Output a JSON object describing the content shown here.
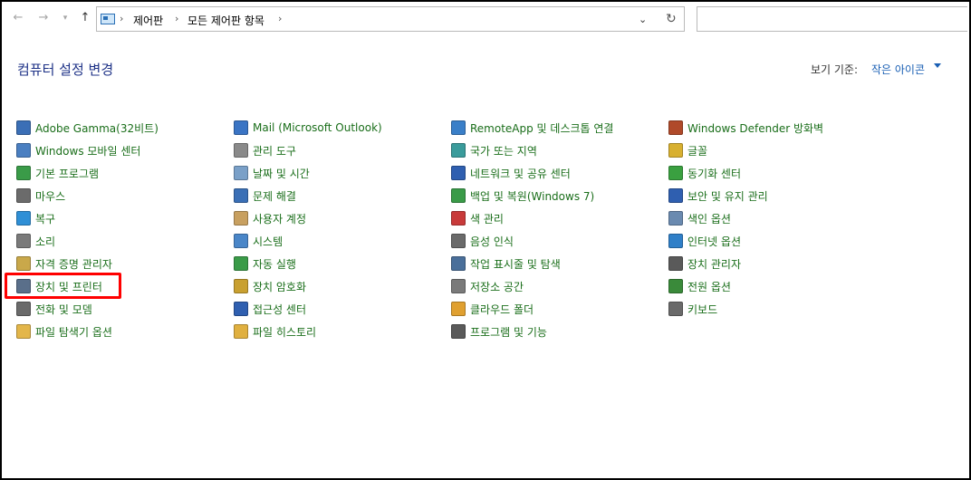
{
  "nav": {
    "back_icon": "arrow-left-icon",
    "forward_icon": "arrow-right-icon",
    "recent_icon": "chevron-down-icon",
    "up_icon": "arrow-up-icon"
  },
  "address": {
    "breadcrumbs": [
      "제어판",
      "모든 제어판 항목"
    ]
  },
  "header": {
    "title": "컴퓨터 설정 변경",
    "view_label": "보기 기준:",
    "view_value": "작은 아이콘"
  },
  "items": [
    {
      "label": "Adobe Gamma(32비트)",
      "icon": "monitor-gamma-icon",
      "color": "#3b6fb6"
    },
    {
      "label": "Windows 모바일 센터",
      "icon": "mobility-center-icon",
      "color": "#4a7fc1"
    },
    {
      "label": "기본 프로그램",
      "icon": "default-programs-icon",
      "color": "#3a9b48"
    },
    {
      "label": "마우스",
      "icon": "mouse-icon",
      "color": "#6b6b6b"
    },
    {
      "label": "복구",
      "icon": "recovery-icon",
      "color": "#2f8fd6"
    },
    {
      "label": "소리",
      "icon": "speaker-icon",
      "color": "#7a7a7a"
    },
    {
      "label": "자격 증명 관리자",
      "icon": "credential-manager-icon",
      "color": "#c9a84a"
    },
    {
      "label": "장치 및 프린터",
      "icon": "devices-printers-icon",
      "color": "#5a6f8a"
    },
    {
      "label": "전화 및 모뎀",
      "icon": "phone-modem-icon",
      "color": "#6a6a6a"
    },
    {
      "label": "파일 탐색기 옵션",
      "icon": "folder-options-icon",
      "color": "#e3b64a"
    },
    {
      "label": "Mail (Microsoft Outlook)",
      "icon": "mail-icon",
      "color": "#3a74c4"
    },
    {
      "label": "관리 도구",
      "icon": "admin-tools-icon",
      "color": "#8a8a8a"
    },
    {
      "label": "날짜 및 시간",
      "icon": "clock-icon",
      "color": "#7aa0c8"
    },
    {
      "label": "문제 해결",
      "icon": "troubleshoot-icon",
      "color": "#3a6fb6"
    },
    {
      "label": "사용자 계정",
      "icon": "user-accounts-icon",
      "color": "#c8a060"
    },
    {
      "label": "시스템",
      "icon": "system-icon",
      "color": "#4a86c8"
    },
    {
      "label": "자동 실행",
      "icon": "autoplay-icon",
      "color": "#3a9b48"
    },
    {
      "label": "장치 암호화",
      "icon": "device-encryption-icon",
      "color": "#c9a030"
    },
    {
      "label": "접근성 센터",
      "icon": "ease-of-access-icon",
      "color": "#2f5fb0"
    },
    {
      "label": "파일 히스토리",
      "icon": "file-history-icon",
      "color": "#e0b040"
    },
    {
      "label": "RemoteApp 및 데스크톱 연결",
      "icon": "remoteapp-icon",
      "color": "#3a7fc8"
    },
    {
      "label": "국가 또는 지역",
      "icon": "region-globe-icon",
      "color": "#3a9b9b"
    },
    {
      "label": "네트워크 및 공유 센터",
      "icon": "network-center-icon",
      "color": "#2f5fb0"
    },
    {
      "label": "백업 및 복원(Windows 7)",
      "icon": "backup-restore-icon",
      "color": "#3a9b48"
    },
    {
      "label": "색 관리",
      "icon": "color-management-icon",
      "color": "#c83a3a"
    },
    {
      "label": "음성 인식",
      "icon": "microphone-icon",
      "color": "#6a6a6a"
    },
    {
      "label": "작업 표시줄 및 탐색",
      "icon": "taskbar-icon",
      "color": "#4a6f9a"
    },
    {
      "label": "저장소 공간",
      "icon": "storage-spaces-icon",
      "color": "#7a7a7a"
    },
    {
      "label": "클라우드 폴더",
      "icon": "work-folders-icon",
      "color": "#e0a030"
    },
    {
      "label": "프로그램 및 기능",
      "icon": "programs-features-icon",
      "color": "#5a5a5a"
    },
    {
      "label": "Windows Defender 방화벽",
      "icon": "firewall-icon",
      "color": "#b04a2a"
    },
    {
      "label": "글꼴",
      "icon": "fonts-icon",
      "color": "#d8b030"
    },
    {
      "label": "동기화 센터",
      "icon": "sync-center-icon",
      "color": "#3aa040"
    },
    {
      "label": "보안 및 유지 관리",
      "icon": "security-flag-icon",
      "color": "#2f5fb0"
    },
    {
      "label": "색인 옵션",
      "icon": "indexing-options-icon",
      "color": "#6a8ab0"
    },
    {
      "label": "인터넷 옵션",
      "icon": "internet-options-icon",
      "color": "#2f7fc8"
    },
    {
      "label": "장치 관리자",
      "icon": "device-manager-icon",
      "color": "#5a5a5a"
    },
    {
      "label": "전원 옵션",
      "icon": "power-options-icon",
      "color": "#3a8a3a"
    },
    {
      "label": "키보드",
      "icon": "keyboard-icon",
      "color": "#6a6a6a"
    }
  ]
}
